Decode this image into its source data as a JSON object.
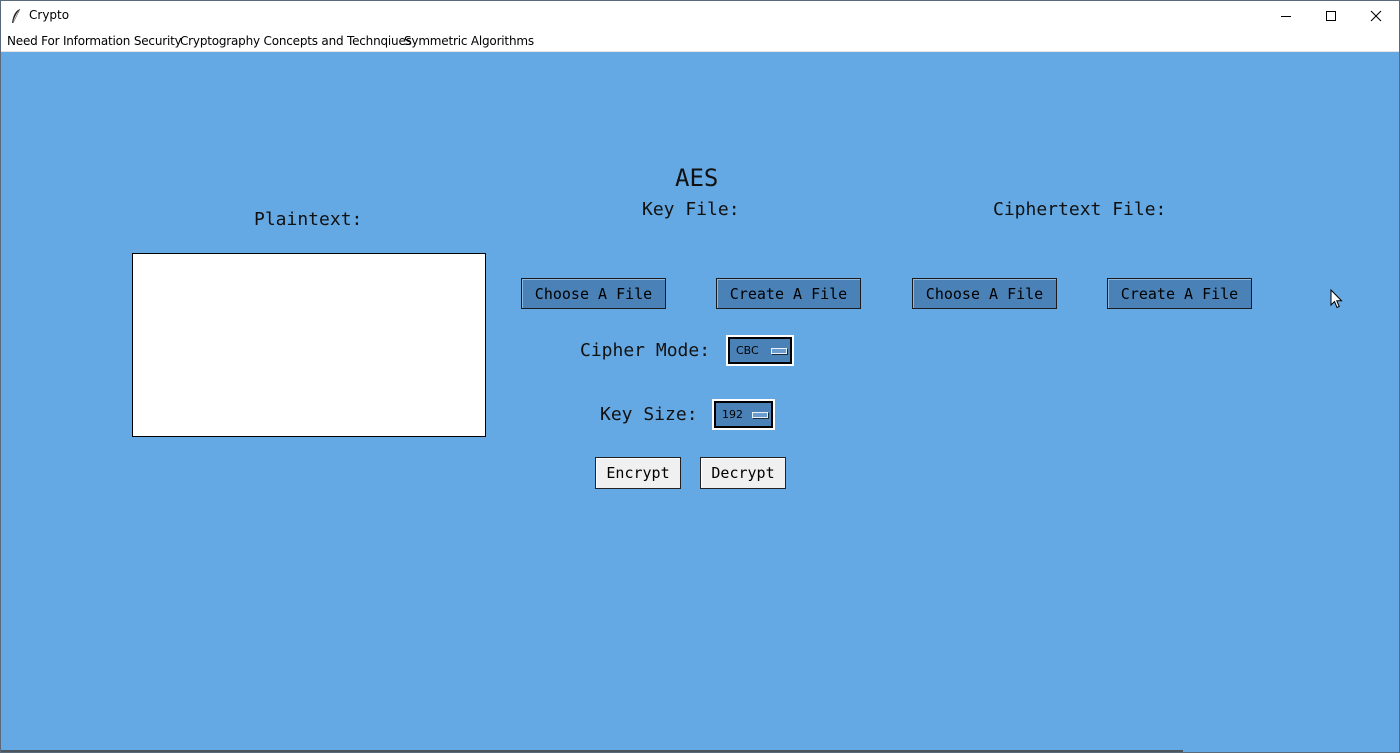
{
  "window": {
    "title": "Crypto",
    "icon": "feather-icon",
    "controls": [
      "minimize-icon",
      "maximize-icon",
      "close-icon"
    ]
  },
  "menubar": {
    "items": [
      "Need For Information Security",
      "Cryptography Concepts and Technqiues",
      "Symmetric Algorithms"
    ]
  },
  "main": {
    "heading": "AES",
    "plaintext_label": "Plaintext:",
    "plaintext_value": "",
    "key_file_label": "Key File:",
    "ciphertext_file_label": "Ciphertext File:",
    "key_file_buttons": {
      "choose": "Choose A File",
      "create": "Create A File"
    },
    "ciphertext_file_buttons": {
      "choose": "Choose A File",
      "create": "Create A File"
    },
    "cipher_mode": {
      "label": "Cipher Mode:",
      "selected": "CBC"
    },
    "key_size": {
      "label": "Key Size:",
      "selected": "192"
    },
    "encrypt_label": "Encrypt",
    "decrypt_label": "Decrypt"
  },
  "colors": {
    "background": "#64a9e3",
    "button_blue": "#4a82b8",
    "button_gray": "#f0f0f0"
  }
}
